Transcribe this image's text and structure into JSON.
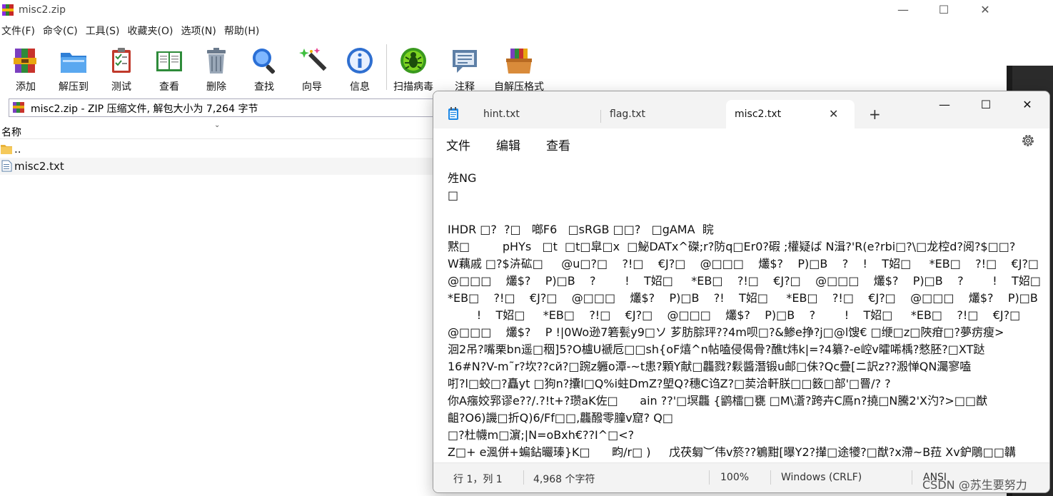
{
  "winrar": {
    "title": "misc2.zip",
    "controls": {
      "minimize": "—",
      "maximize": "☐",
      "close": "✕"
    },
    "menu": [
      "文件(F)",
      "命令(C)",
      "工具(S)",
      "收藏夹(O)",
      "选项(N)",
      "帮助(H)"
    ],
    "toolbar": [
      {
        "label": "添加",
        "icon": "add-archive-icon"
      },
      {
        "label": "解压到",
        "icon": "extract-folder-icon"
      },
      {
        "label": "测试",
        "icon": "test-clipboard-icon"
      },
      {
        "label": "查看",
        "icon": "view-book-icon"
      },
      {
        "label": "删除",
        "icon": "trash-icon"
      },
      {
        "label": "查找",
        "icon": "magnifier-icon"
      },
      {
        "label": "向导",
        "icon": "wizard-wand-icon"
      },
      {
        "label": "信息",
        "icon": "info-icon"
      },
      {
        "label": "扫描病毒",
        "icon": "virus-scan-icon"
      },
      {
        "label": "注释",
        "icon": "comment-icon"
      },
      {
        "label": "自解压格式",
        "icon": "sfx-box-icon"
      }
    ],
    "path_text": "misc2.zip - ZIP 压缩文件, 解包大小为 7,264 字节",
    "column_name": "名称",
    "files": [
      {
        "name": "..",
        "icon": "folder-up-icon"
      },
      {
        "name": "misc2.txt",
        "icon": "text-file-icon"
      }
    ]
  },
  "notepad": {
    "tabs": [
      {
        "label": "hint.txt",
        "active": false
      },
      {
        "label": "flag.txt",
        "active": false
      },
      {
        "label": "misc2.txt",
        "active": true
      }
    ],
    "new_tab": "+",
    "close_tab": "✕",
    "controls": {
      "minimize": "—",
      "maximize": "☐",
      "close": "✕"
    },
    "menu": [
      "文件",
      "编辑",
      "查看"
    ],
    "content_lines": [
      "夝NG",
      "□",
      "",
      "IHDR □?  ?□   啷F6   □sRGB □□?   □gAMA  睆",
      "黙□         pHYs   □t  □t□皐□x  □鮅DATx^磔;r?防q□Er0?碬 ;權疑ば N湒?'R(e?rbi□?\\□龙椌d?阅?$□□?",
      "W藕戚 □?$泋砿□     @u□?□    ?!□    €J?□    @□□□    爜$?    P)□B    ?    !    T妱□     *EB□    ?!□    €J?□",
      "@□□□    爜$?    P)□B    ?        !    T妱□     *EB□    ?!□    €J?□    @□□□    爜$?    P)□B    ?        !    T妱□",
      "*EB□    ?!□    €J?□    @□□□    爜$?    P)□B    ?!    T妱□     *EB□    ?!□    €J?□    @□□□    爜$?    P)□B    ?",
      "        !    T妱□     *EB□    ?!□    €J?□    @□□□    爜$?    P)□B    ?        !    T妱□     *EB□    ?!□    €J?□",
      "@□□□    爜$?    P !|0Wo逊7箬甏y9□ソ 芗肪腙玶??4m呗□?&鯵e挣?j□@l馊€ □缏□z□陜疳□?夢疠瘦>",
      "洄2吊?嘴栗bn遥□秵]5?O櫨U褫卮□□sh{oF熺^n帖嗑侵偈骨?醮t炜k|=?4纂?-e崆v曤唏楀?憗胚?□XT跶",
      "16#N?V-m˜r?坎??cй?□踠z軅o潭-~t患?顆Y献□龘戮?鬏醬潛锻u邮□佅?Qc疊[ニ訳z??溵惮QN灟寥嗑",
      "咑?l□蛟□?矗yt □狗n?攮l□Q%i蛀DmZ?塱Q?穗C诌Z?□荬洽軒朕□□䉤□部'□罾/? ?",
      "你A瘬姣郛谬e??/.?!t+?瓒aK佐□      ain ??'□塓龘 {鹠檑□甕 □M\\濸?跨卉C鳫n?撓□N騰2'X汋?>□□猷",
      "齟?O6)譏□折Q)6/Ff□□,龘醱零膧v窟? Q□",
      "□?杜幭m□濵;|N=oBxh€??I^□<?",
      "Z□+ e渢併+蝙鉆曮瑧}K□      畇/r□ )     戊茯匔︶伟v箊??鵴黚[曝Y2?攆□途犪?□猷?x滯~B菈 Xv鈩鵰□□韝"
    ],
    "status": {
      "position": "行 1，列 1",
      "chars": "4,968 个字符",
      "zoom": "100%",
      "line_ending": "Windows (CRLF)",
      "encoding": "ANSI"
    }
  },
  "watermark": "CSDN @苏生要努力"
}
